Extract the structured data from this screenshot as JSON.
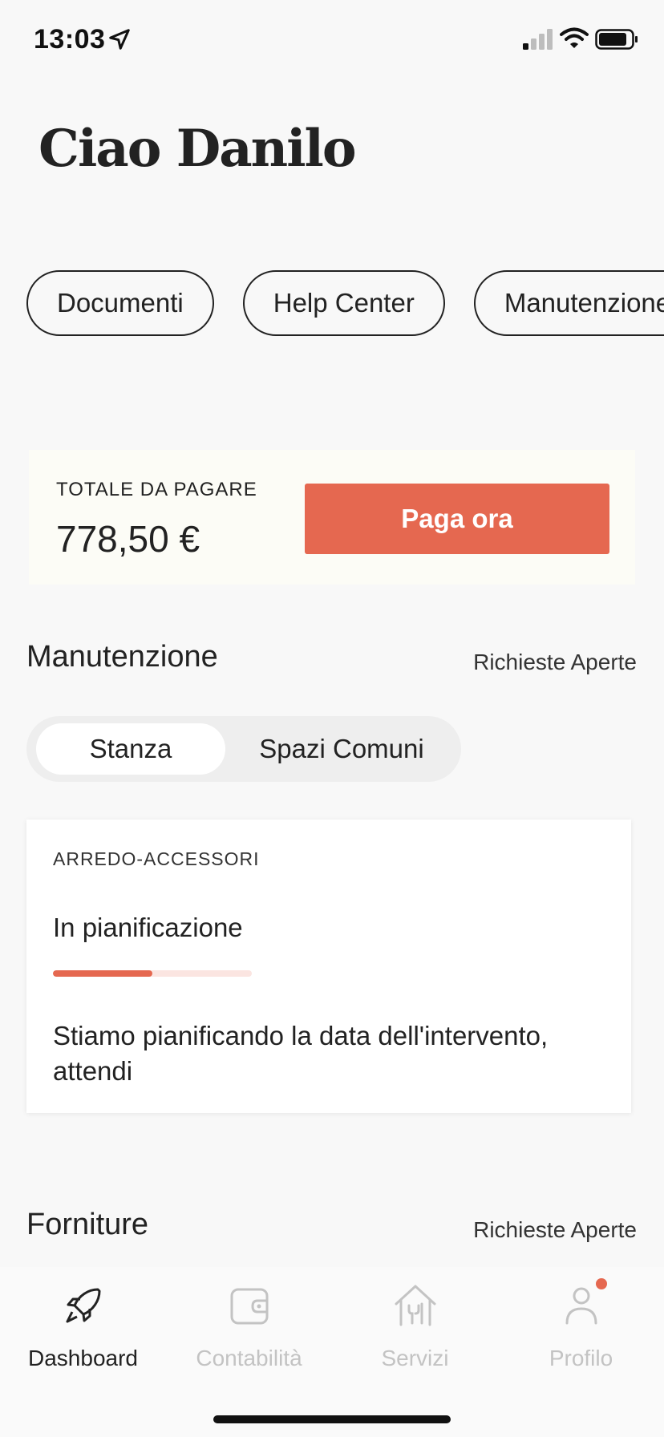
{
  "status_bar": {
    "time": "13:03"
  },
  "greeting": "Ciao Danilo",
  "chips": [
    "Documenti",
    "Help Center",
    "Manutenzione"
  ],
  "payment": {
    "label": "TOTALE DA PAGARE",
    "amount": "778,50 €",
    "button": "Paga ora"
  },
  "maintenance": {
    "title": "Manutenzione",
    "link": "Richieste Aperte",
    "segments": {
      "active": "Stanza",
      "inactive": "Spazi Comuni"
    },
    "card": {
      "category": "ARREDO-ACCESSORI",
      "status": "In pianificazione",
      "progress": 0.5,
      "description": "Stiamo pianificando la data dell'intervento, attendi"
    }
  },
  "supplies": {
    "title": "Forniture",
    "link": "Richieste Aperte"
  },
  "tabs": [
    {
      "label": "Dashboard",
      "icon": "rocket-icon",
      "active": true
    },
    {
      "label": "Contabilità",
      "icon": "wallet-icon",
      "active": false
    },
    {
      "label": "Servizi",
      "icon": "house-tools-icon",
      "active": false
    },
    {
      "label": "Profilo",
      "icon": "person-icon",
      "active": false,
      "badge": true
    }
  ],
  "colors": {
    "accent": "#e56850",
    "inactive_tab": "#c3c3c3",
    "card_bg": "#fcfcf6"
  }
}
